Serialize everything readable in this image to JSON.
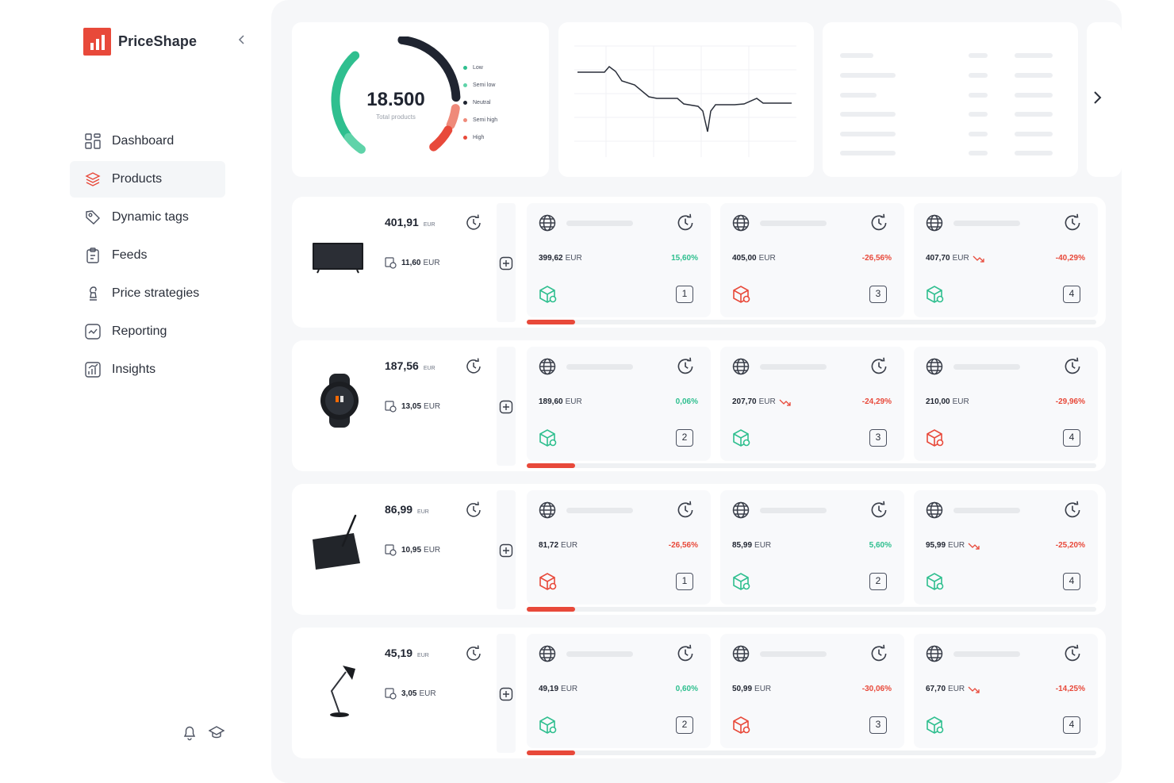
{
  "brand": {
    "name": "PriceShape",
    "color": "#e8493a"
  },
  "sidebar": {
    "collapse_icon": "chevron-left-icon",
    "items": [
      {
        "label": "Dashboard",
        "icon": "dashboard-icon",
        "active": false
      },
      {
        "label": "Products",
        "icon": "layers-icon",
        "active": true
      },
      {
        "label": "Dynamic tags",
        "icon": "tag-icon",
        "active": false
      },
      {
        "label": "Feeds",
        "icon": "clipboard-icon",
        "active": false
      },
      {
        "label": "Price strategies",
        "icon": "strategy-icon",
        "active": false
      },
      {
        "label": "Reporting",
        "icon": "reporting-icon",
        "active": false
      },
      {
        "label": "Insights",
        "icon": "insights-icon",
        "active": false
      }
    ],
    "footer_icons": [
      "bell-icon",
      "graduation-cap-icon"
    ]
  },
  "summary": {
    "total_value": "18.500",
    "total_label": "Total products",
    "legend": [
      {
        "label": "Low",
        "color": "#2fbf8f"
      },
      {
        "label": "Semi low",
        "color": "#5fd3a9"
      },
      {
        "label": "Neutral",
        "color": "#1f2430"
      },
      {
        "label": "Semi high",
        "color": "#ef8a7a"
      },
      {
        "label": "High",
        "color": "#e8493a"
      }
    ]
  },
  "colors": {
    "up": "#2fbf8f",
    "down": "#e8493a",
    "box_green": "#2fbf8f",
    "box_red": "#e8493a"
  },
  "products": [
    {
      "image": "tv",
      "price": "401,91",
      "currency": "EUR",
      "shipping": "11,60",
      "shipping_currency": "EUR",
      "progress": 0.085,
      "competitors": [
        {
          "price": "399,62",
          "currency": "EUR",
          "change": "15,60%",
          "direction": "up",
          "trend": false,
          "box": "green",
          "rank": "1"
        },
        {
          "price": "405,00",
          "currency": "EUR",
          "change": "-26,56%",
          "direction": "down",
          "trend": false,
          "box": "red",
          "rank": "3"
        },
        {
          "price": "407,70",
          "currency": "EUR",
          "change": "-40,29%",
          "direction": "down",
          "trend": true,
          "box": "green",
          "rank": "4"
        }
      ]
    },
    {
      "image": "watch",
      "price": "187,56",
      "currency": "EUR",
      "shipping": "13,05",
      "shipping_currency": "EUR",
      "progress": 0.085,
      "competitors": [
        {
          "price": "189,60",
          "currency": "EUR",
          "change": "0,06%",
          "direction": "up",
          "trend": false,
          "box": "green",
          "rank": "2"
        },
        {
          "price": "207,70",
          "currency": "EUR",
          "change": "-24,29%",
          "direction": "down",
          "trend": true,
          "box": "green",
          "rank": "3"
        },
        {
          "price": "210,00",
          "currency": "EUR",
          "change": "-29,96%",
          "direction": "down",
          "trend": false,
          "box": "red",
          "rank": "4"
        }
      ]
    },
    {
      "image": "tablet",
      "price": "86,99",
      "currency": "EUR",
      "shipping": "10,95",
      "shipping_currency": "EUR",
      "progress": 0.085,
      "competitors": [
        {
          "price": "81,72",
          "currency": "EUR",
          "change": "-26,56%",
          "direction": "down",
          "trend": false,
          "box": "red",
          "rank": "1"
        },
        {
          "price": "85,99",
          "currency": "EUR",
          "change": "5,60%",
          "direction": "up",
          "trend": false,
          "box": "green",
          "rank": "2"
        },
        {
          "price": "95,99",
          "currency": "EUR",
          "change": "-25,20%",
          "direction": "down",
          "trend": true,
          "box": "green",
          "rank": "4"
        }
      ]
    },
    {
      "image": "lamp",
      "price": "45,19",
      "currency": "EUR",
      "shipping": "3,05",
      "shipping_currency": "EUR",
      "progress": 0.085,
      "competitors": [
        {
          "price": "49,19",
          "currency": "EUR",
          "change": "0,60%",
          "direction": "up",
          "trend": false,
          "box": "green",
          "rank": "2"
        },
        {
          "price": "50,99",
          "currency": "EUR",
          "change": "-30,06%",
          "direction": "down",
          "trend": false,
          "box": "red",
          "rank": "3"
        },
        {
          "price": "67,70",
          "currency": "EUR",
          "change": "-14,25%",
          "direction": "down",
          "trend": true,
          "box": "green",
          "rank": "4"
        }
      ]
    }
  ]
}
